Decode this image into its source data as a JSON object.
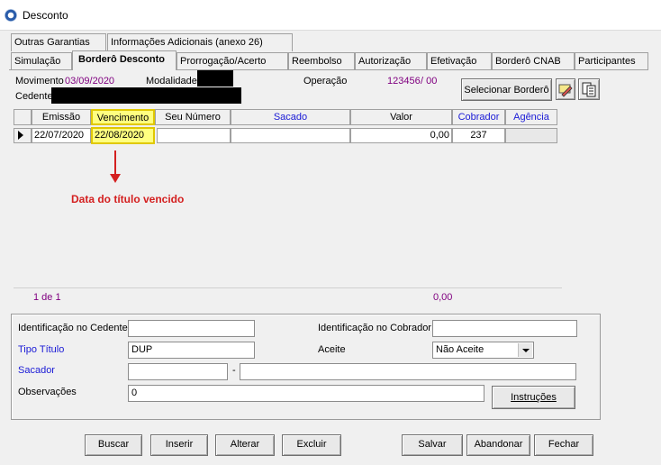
{
  "window": {
    "title": "Desconto"
  },
  "tabs_row1": [
    "Outras Garantias",
    "Informações Adicionais (anexo 26)"
  ],
  "tabs_row2": [
    "Simulação",
    "Borderô Desconto",
    "Prorrogação/Acerto",
    "Reembolso",
    "Autorização",
    "Efetivação",
    "Borderô CNAB",
    "Participantes"
  ],
  "header": {
    "movimento_label": "Movimento",
    "movimento_value": "03/09/2020",
    "modalidade_label": "Modalidade",
    "operacao_label": "Operação",
    "operacao_value": "123456",
    "operacao_suffix": "/ 00",
    "cedente_label": "Cedente",
    "select_bordero_label": "Selecionar Borderô"
  },
  "grid": {
    "columns": [
      "Emissão",
      "Vencimento",
      "Seu Número",
      "Sacado",
      "Valor",
      "Cobrador",
      "Agência"
    ],
    "row": {
      "emissao": "22/07/2020",
      "vencimento": "22/08/2020",
      "seu_numero": "",
      "sacado": "",
      "valor": "0,00",
      "cobrador": "237",
      "agencia": ""
    },
    "footer_count": "1 de 1",
    "footer_total": "0,00"
  },
  "annotation": {
    "text": "Data do título vencido",
    "color": "#d42020"
  },
  "form": {
    "id_cedente_label": "Identificação no Cedente",
    "id_cedente_value": "",
    "id_cobrador_label": "Identificação no Cobrador",
    "id_cobrador_value": "",
    "tipo_titulo_label": "Tipo Título",
    "tipo_titulo_value": "DUP",
    "aceite_label": "Aceite",
    "aceite_value": "Não Aceite",
    "sacador_label": "Sacador",
    "sacador_separator": "-",
    "observacoes_label": "Observações",
    "observacoes_value": "0",
    "instrucoes_label": "Instruções"
  },
  "buttons": [
    "Buscar",
    "Inserir",
    "Alterar",
    "Excluir",
    "Salvar",
    "Abandonar",
    "Fechar"
  ],
  "colors": {
    "purple_value": "#800080",
    "blue_label": "#1a1ad6",
    "highlight": "#ffff80"
  }
}
